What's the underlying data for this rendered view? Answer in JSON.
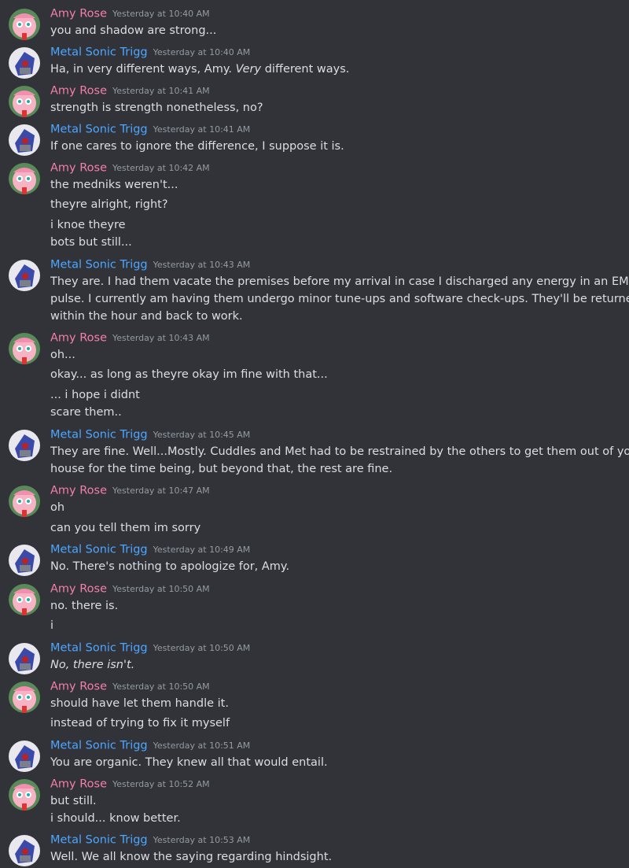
{
  "authors": {
    "amy": {
      "name": "Amy Rose",
      "color": "#f47fa7",
      "avatar": "amy-avatar-icon"
    },
    "metal": {
      "name": "Metal Sonic Trigg",
      "color": "#4da6ff",
      "avatar": "metal-sonic-avatar-icon"
    }
  },
  "messages": [
    {
      "author": "Amy Rose",
      "time": "Yesterday at 10:40 AM",
      "lines": [
        "you and shadow are strong..."
      ]
    },
    {
      "author": "Metal Sonic Trigg",
      "time": "Yesterday at 10:40 AM",
      "lines_rich": [
        [
          "Ha, in very different ways, Amy. ",
          "Very",
          " different ways."
        ]
      ]
    },
    {
      "author": "Amy Rose",
      "time": "Yesterday at 10:41 AM",
      "lines": [
        "strength is strength nonetheless, no?"
      ]
    },
    {
      "author": "Metal Sonic Trigg",
      "time": "Yesterday at 10:41 AM",
      "lines": [
        "If one cares to ignore the difference, I suppose it is."
      ]
    },
    {
      "author": "Amy Rose",
      "time": "Yesterday at 10:42 AM",
      "lines": [
        "the medniks weren't...",
        "theyre alright, right?",
        "i knoe theyre",
        "bots but still..."
      ]
    },
    {
      "author": "Metal Sonic Trigg",
      "time": "Yesterday at 10:43 AM",
      "lines": [
        "They are. I had them vacate the premises before my arrival in case I discharged any energy in an EMP",
        "pulse. I currently am having them undergo minor tune-ups and software check-ups. They'll be returned",
        "within the hour and back to work."
      ]
    },
    {
      "author": "Amy Rose",
      "time": "Yesterday at 10:43 AM",
      "lines": [
        "oh...",
        "okay... as long as theyre okay im fine with that...",
        "... i hope i didnt",
        "scare them.."
      ]
    },
    {
      "author": "Metal Sonic Trigg",
      "time": "Yesterday at 10:45 AM",
      "lines": [
        "They are fine. Well...Mostly. Cuddles and Met had to be restrained by the others to get them out of your",
        "house for the time being, but beyond that, the rest are fine."
      ]
    },
    {
      "author": "Amy Rose",
      "time": "Yesterday at 10:47 AM",
      "lines": [
        "oh",
        "can you tell them im sorry"
      ]
    },
    {
      "author": "Metal Sonic Trigg",
      "time": "Yesterday at 10:49 AM",
      "lines": [
        "No. There's nothing to apologize for, Amy."
      ]
    },
    {
      "author": "Amy Rose",
      "time": "Yesterday at 10:50 AM",
      "lines": [
        "no. there is.",
        "i"
      ]
    },
    {
      "author": "Metal Sonic Trigg",
      "time": "Yesterday at 10:50 AM",
      "italic_line": "No, there isn't."
    },
    {
      "author": "Amy Rose",
      "time": "Yesterday at 10:50 AM",
      "lines": [
        "should have let them handle it.",
        "instead of trying to fix it myself"
      ]
    },
    {
      "author": "Metal Sonic Trigg",
      "time": "Yesterday at 10:51 AM",
      "lines": [
        "You are organic. They knew all that would entail."
      ]
    },
    {
      "author": "Amy Rose",
      "time": "Yesterday at 10:52 AM",
      "lines": [
        "but still.",
        "i should... know better."
      ]
    },
    {
      "author": "Metal Sonic Trigg",
      "time": "Yesterday at 10:53 AM",
      "lines": [
        "Well. We all know the saying regarding hindsight."
      ]
    }
  ]
}
